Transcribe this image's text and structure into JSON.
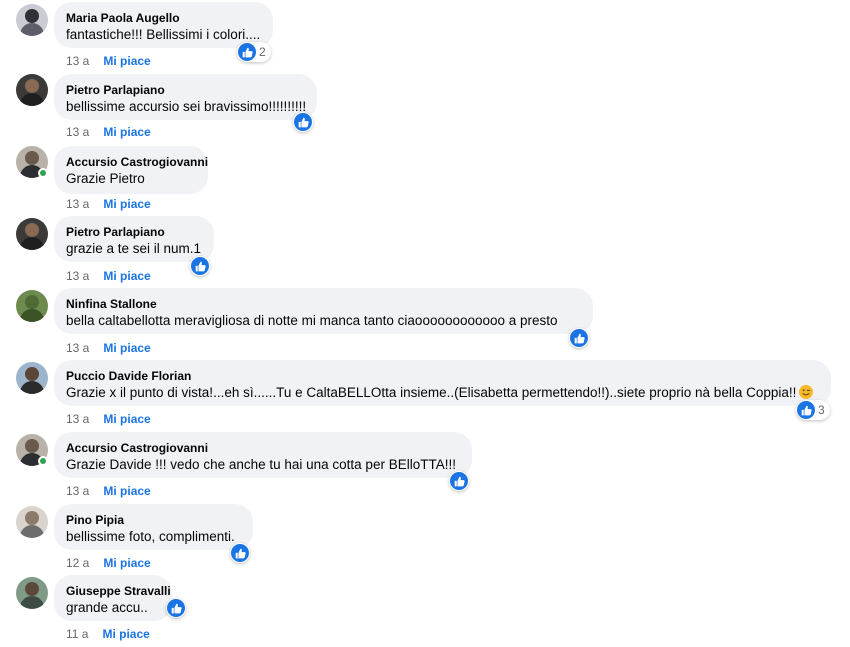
{
  "colors": {
    "like_blue": "#1b74e4",
    "bubble_bg": "#f0f2f5",
    "meta_gray": "#65676b",
    "online_green": "#31a24c"
  },
  "like_label": "Mi piace",
  "comments": [
    {
      "author": "Maria Paola Augello",
      "text": "fantastiche!!! Bellissimi i colori....",
      "time": "13 a",
      "reactions": "2"
    },
    {
      "author": "Pietro Parlapiano",
      "text": "bellissime accursio sei bravissimo!!!!!!!!!!",
      "time": "13 a",
      "reactions": ""
    },
    {
      "author": "Accursio Castrogiovanni",
      "text": "Grazie Pietro",
      "time": "13 a",
      "reactions": ""
    },
    {
      "author": "Pietro Parlapiano",
      "text": "grazie a te sei il num.1",
      "time": "13 a",
      "reactions": ""
    },
    {
      "author": "Ninfina Stallone",
      "text": "bella caltabellotta meravigliosa di notte mi manca tanto ciaoooooooooooo a presto",
      "time": "13 a",
      "reactions": ""
    },
    {
      "author": "Puccio Davide Florian",
      "text": "Grazie x il punto di vista!...eh sì......Tu e CaltaBELLOtta insieme..(Elisabetta permettendo!!)..siete proprio nà bella Coppia!!",
      "time": "13 a",
      "reactions": "3",
      "emoji": "winking-face"
    },
    {
      "author": "Accursio Castrogiovanni",
      "text": "Grazie Davide !!! vedo che anche tu hai una cotta per BElloTTA!!!",
      "time": "13 a",
      "reactions": ""
    },
    {
      "author": "Pino Pipia",
      "text": "bellissime foto, complimenti.",
      "time": "12 a",
      "reactions": ""
    },
    {
      "author": "Giuseppe Stravalli",
      "text": "grande accu..",
      "time": "11 a",
      "reactions": ""
    }
  ]
}
